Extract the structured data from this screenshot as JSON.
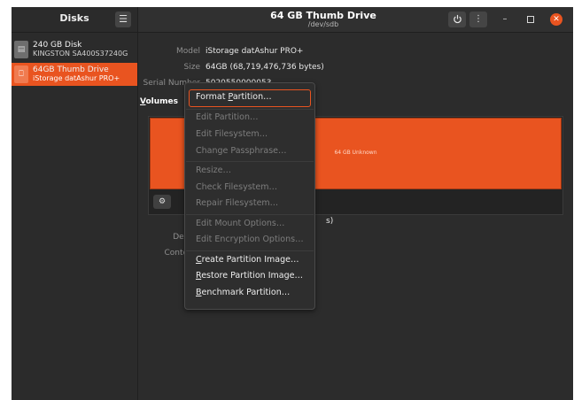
{
  "app": {
    "title": "Disks"
  },
  "window": {
    "title": "64 GB Thumb Drive",
    "subtitle": "/dev/sdb"
  },
  "colors": {
    "accent": "#e95420",
    "sidebar_bg": "#2b2b2b",
    "main_bg": "#2c2c2c",
    "menu_bg": "#2e2e2e"
  },
  "icons": {
    "menu": "hamburger-icon",
    "power": "power-icon",
    "more": "vertical-dots-icon",
    "minimize": "minimize-icon",
    "maximize": "maximize-icon",
    "close": "close-icon",
    "disk": "hard-disk-icon",
    "usb": "usb-icon",
    "gear": "gears-icon"
  },
  "sidebar": {
    "items": [
      {
        "name": "240 GB Disk",
        "sub": "KINGSTON SA400S37240G",
        "selected": false
      },
      {
        "name": "64GB Thumb Drive",
        "sub": "iStorage datAshur PRO+",
        "selected": true
      }
    ]
  },
  "drive": {
    "model_label": "Model",
    "model": "iStorage datAshur PRO+",
    "size_label": "Size",
    "size": "64GB (68,719,476,736 bytes)",
    "serial_label": "Serial Number",
    "serial": "5020550000053"
  },
  "volumes": {
    "label_pre": "",
    "label_mn": "V",
    "label_post": "olumes",
    "partition_text": "64 GB Unknown",
    "size_label": "Size",
    "device_label": "Device",
    "contents_label": "Contents",
    "size_value_fragment": "s)"
  },
  "menu": {
    "items": [
      {
        "pre": "Format ",
        "mn": "P",
        "post": "artition…",
        "enabled": true,
        "highlighted": true
      },
      {
        "pre": "Edit Partition…",
        "mn": "",
        "post": "",
        "enabled": false
      },
      {
        "pre": "Edit Filesystem…",
        "mn": "",
        "post": "",
        "enabled": false
      },
      {
        "pre": "Change Passphrase…",
        "mn": "",
        "post": "",
        "enabled": false
      },
      {
        "pre": "Resize…",
        "mn": "",
        "post": "",
        "enabled": false
      },
      {
        "pre": "Check Filesystem…",
        "mn": "",
        "post": "",
        "enabled": false
      },
      {
        "pre": "Repair Filesystem…",
        "mn": "",
        "post": "",
        "enabled": false
      },
      {
        "pre": "Edit Mount Options…",
        "mn": "",
        "post": "",
        "enabled": false
      },
      {
        "pre": "Edit Encryption Options…",
        "mn": "",
        "post": "",
        "enabled": false
      },
      {
        "pre": "",
        "mn": "C",
        "post": "reate Partition Image…",
        "enabled": true
      },
      {
        "pre": "",
        "mn": "R",
        "post": "estore Partition Image…",
        "enabled": true
      },
      {
        "pre": "",
        "mn": "B",
        "post": "enchmark Partition…",
        "enabled": true
      }
    ]
  }
}
